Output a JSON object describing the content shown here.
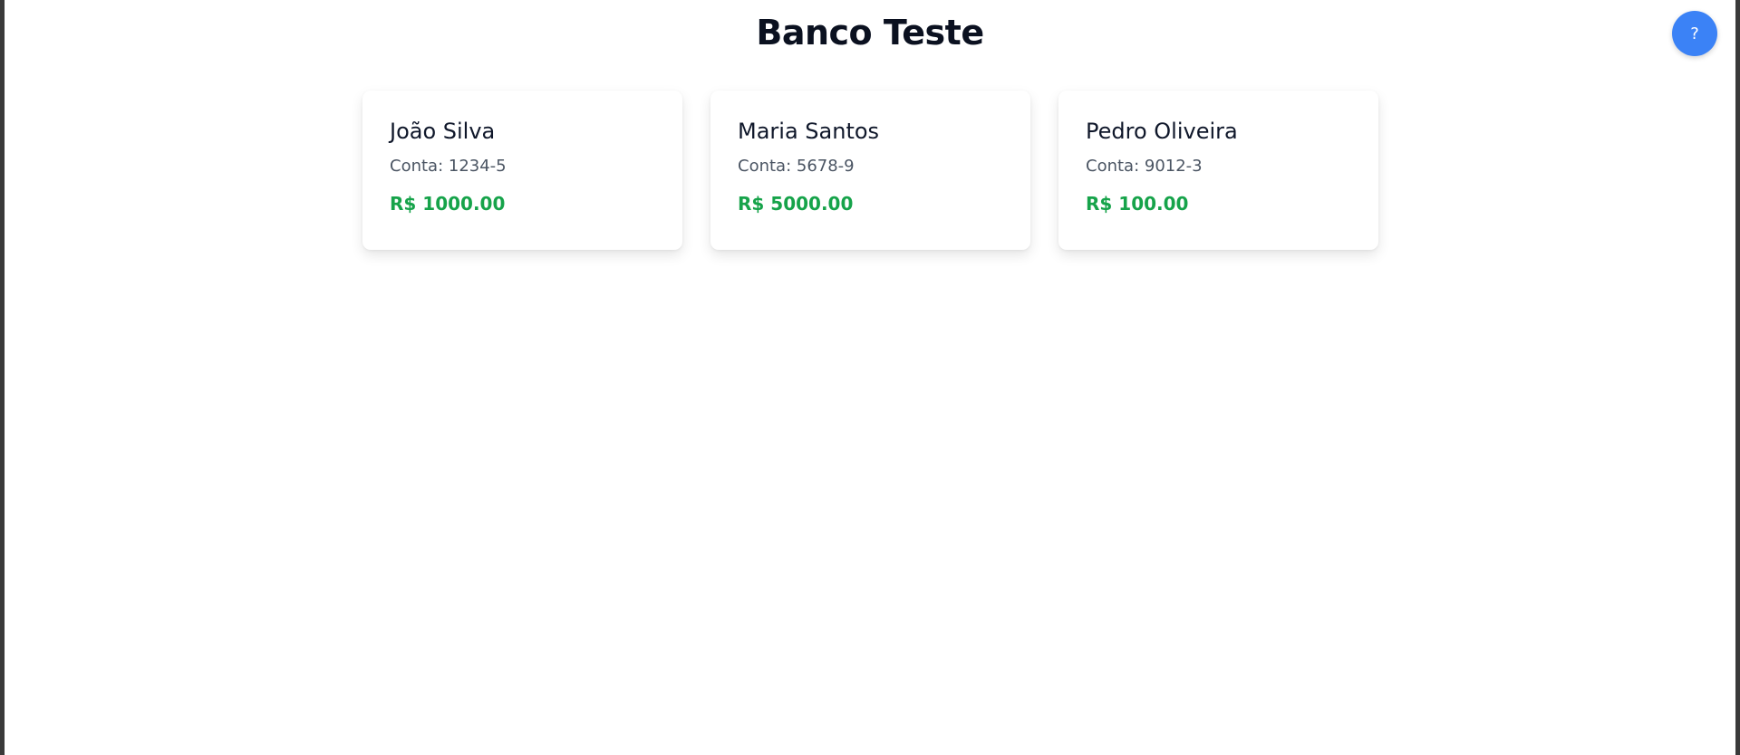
{
  "header": {
    "title": "Banco Teste",
    "help_label": "?"
  },
  "accounts": [
    {
      "name": "João Silva",
      "account": "Conta: 1234-5",
      "balance": "R$ 1000.00"
    },
    {
      "name": "Maria Santos",
      "account": "Conta: 5678-9",
      "balance": "R$ 5000.00"
    },
    {
      "name": "Pedro Oliveira",
      "account": "Conta: 9012-3",
      "balance": "R$ 100.00"
    }
  ],
  "colors": {
    "accent": "#3b82f6",
    "balance": "#16a34a",
    "title": "#0b1120"
  }
}
